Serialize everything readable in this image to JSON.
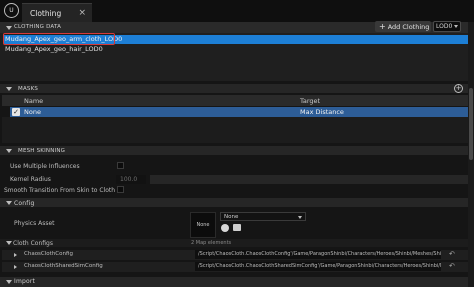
{
  "window": {
    "logo_text": "U",
    "tab_label": "Clothing",
    "tab_close": "×"
  },
  "clothing_data": {
    "title": "CLOTHING DATA",
    "add_button_label": "Add Clothing",
    "add_button_icon": "+",
    "lod_selected": "LOD0",
    "assets": [
      "Mudang_Apex_geo_arm_cloth_LOD0",
      "Mudang_Apex_geo_hair_LOD0"
    ]
  },
  "masks": {
    "title": "MASKS",
    "columns": [
      "Name",
      "Target"
    ],
    "rows": [
      {
        "name": "None",
        "target": "Max Distance",
        "checked": true
      }
    ]
  },
  "mesh_skinning": {
    "title": "MESH SKINNING",
    "use_multiple_influences_label": "Use Multiple Influences",
    "kernel_radius_label": "Kernel Radius",
    "kernel_radius_value": "100.0",
    "smooth_transition_label": "Smooth Transition From Skin to Cloth"
  },
  "config": {
    "title": "Config",
    "physics_asset_label": "Physics Asset",
    "physics_asset_thumb": "None",
    "physics_asset_value": "None",
    "cloth_configs_label": "Cloth Configs",
    "cloth_configs_count": "2 Map elements",
    "entries": [
      {
        "name": "ChaosClothConfig",
        "path": "/Script/ChaosCloth.ChaosClothConfig'/Game/ParagonShinbi/Characters/Heroes/Shinbi/Meshes/Shinbi.Shinbi"
      },
      {
        "name": "ChaosClothSharedSimConfig",
        "path": "/Script/ChaosCloth.ChaosClothSharedSimConfig'/Game/ParagonShinbi/Characters/Heroes/Shinbi/Meshes/Sh"
      }
    ]
  },
  "import": {
    "title": "Import"
  },
  "colors": {
    "selection": "#1d7fd6",
    "highlight_outline": "#d63a3a",
    "mask_row": "#2d5d97"
  },
  "icons": {
    "reset": "reset-arrow-icon",
    "add_mask": "plus-circle-icon",
    "browse": "browse-asset-icon",
    "folder": "folder-icon"
  }
}
